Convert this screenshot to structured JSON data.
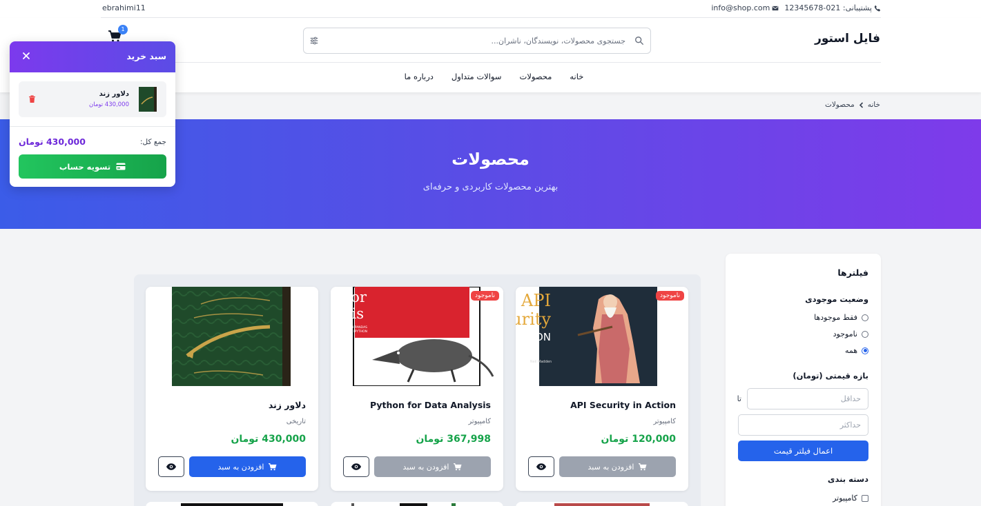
{
  "topbar": {
    "support_label": "پشتیبانی: 021-12345678",
    "email": "info@shop.com",
    "username": "ebrahimi11"
  },
  "header": {
    "logo": "فایل استور",
    "search_placeholder": "جستجوی محصولات، نویسندگان، ناشران...",
    "cart_count": "1",
    "nav": [
      "خانه",
      "محصولات",
      "سوالات متداول",
      "درباره ما"
    ]
  },
  "breadcrumb": {
    "home": "خانه",
    "current": "محصولات"
  },
  "hero": {
    "title": "محصولات",
    "subtitle": "بهترین محصولات کاربردی و حرفه‌ای"
  },
  "filters": {
    "title": "فیلترها",
    "stock_label": "وضعیت موجودی",
    "stock_options": [
      "فقط موجودها",
      "ناموجود",
      "همه"
    ],
    "stock_selected": "همه",
    "price_label": "بازه قیمتی (تومان)",
    "min_placeholder": "حداقل",
    "max_placeholder": "حداکثر",
    "to_label": "تا",
    "apply_label": "اعمال فیلتر قیمت",
    "category_label": "دسته بندی",
    "categories": [
      "کامپیوتر"
    ]
  },
  "products": [
    {
      "title": "API Security in Action",
      "category": "کامپیوتر",
      "price": "120,000 تومان",
      "badge": "ناموجود",
      "add_label": "افزودن به سبد",
      "in_stock": false
    },
    {
      "title": "Python for Data Analysis",
      "category": "کامپیوتر",
      "price": "367,998 تومان",
      "badge": "ناموجود",
      "add_label": "افزودن به سبد",
      "in_stock": false
    },
    {
      "title": "دلاور زند",
      "category": "تاریخی",
      "price": "430,000 تومان",
      "badge": "",
      "add_label": "افزودن به سبد",
      "in_stock": true
    }
  ],
  "cart": {
    "title": "سبد خرید",
    "item_name": "دلاور زند",
    "item_price": "430,000 تومان",
    "total_label": "جمع کل:",
    "total_value": "430,000 تومان",
    "checkout_label": "تسویه حساب"
  },
  "colors": {
    "primary": "#2563eb",
    "price_green": "#16a34a",
    "badge_red": "#ef4444",
    "purple": "#7c3aed"
  }
}
